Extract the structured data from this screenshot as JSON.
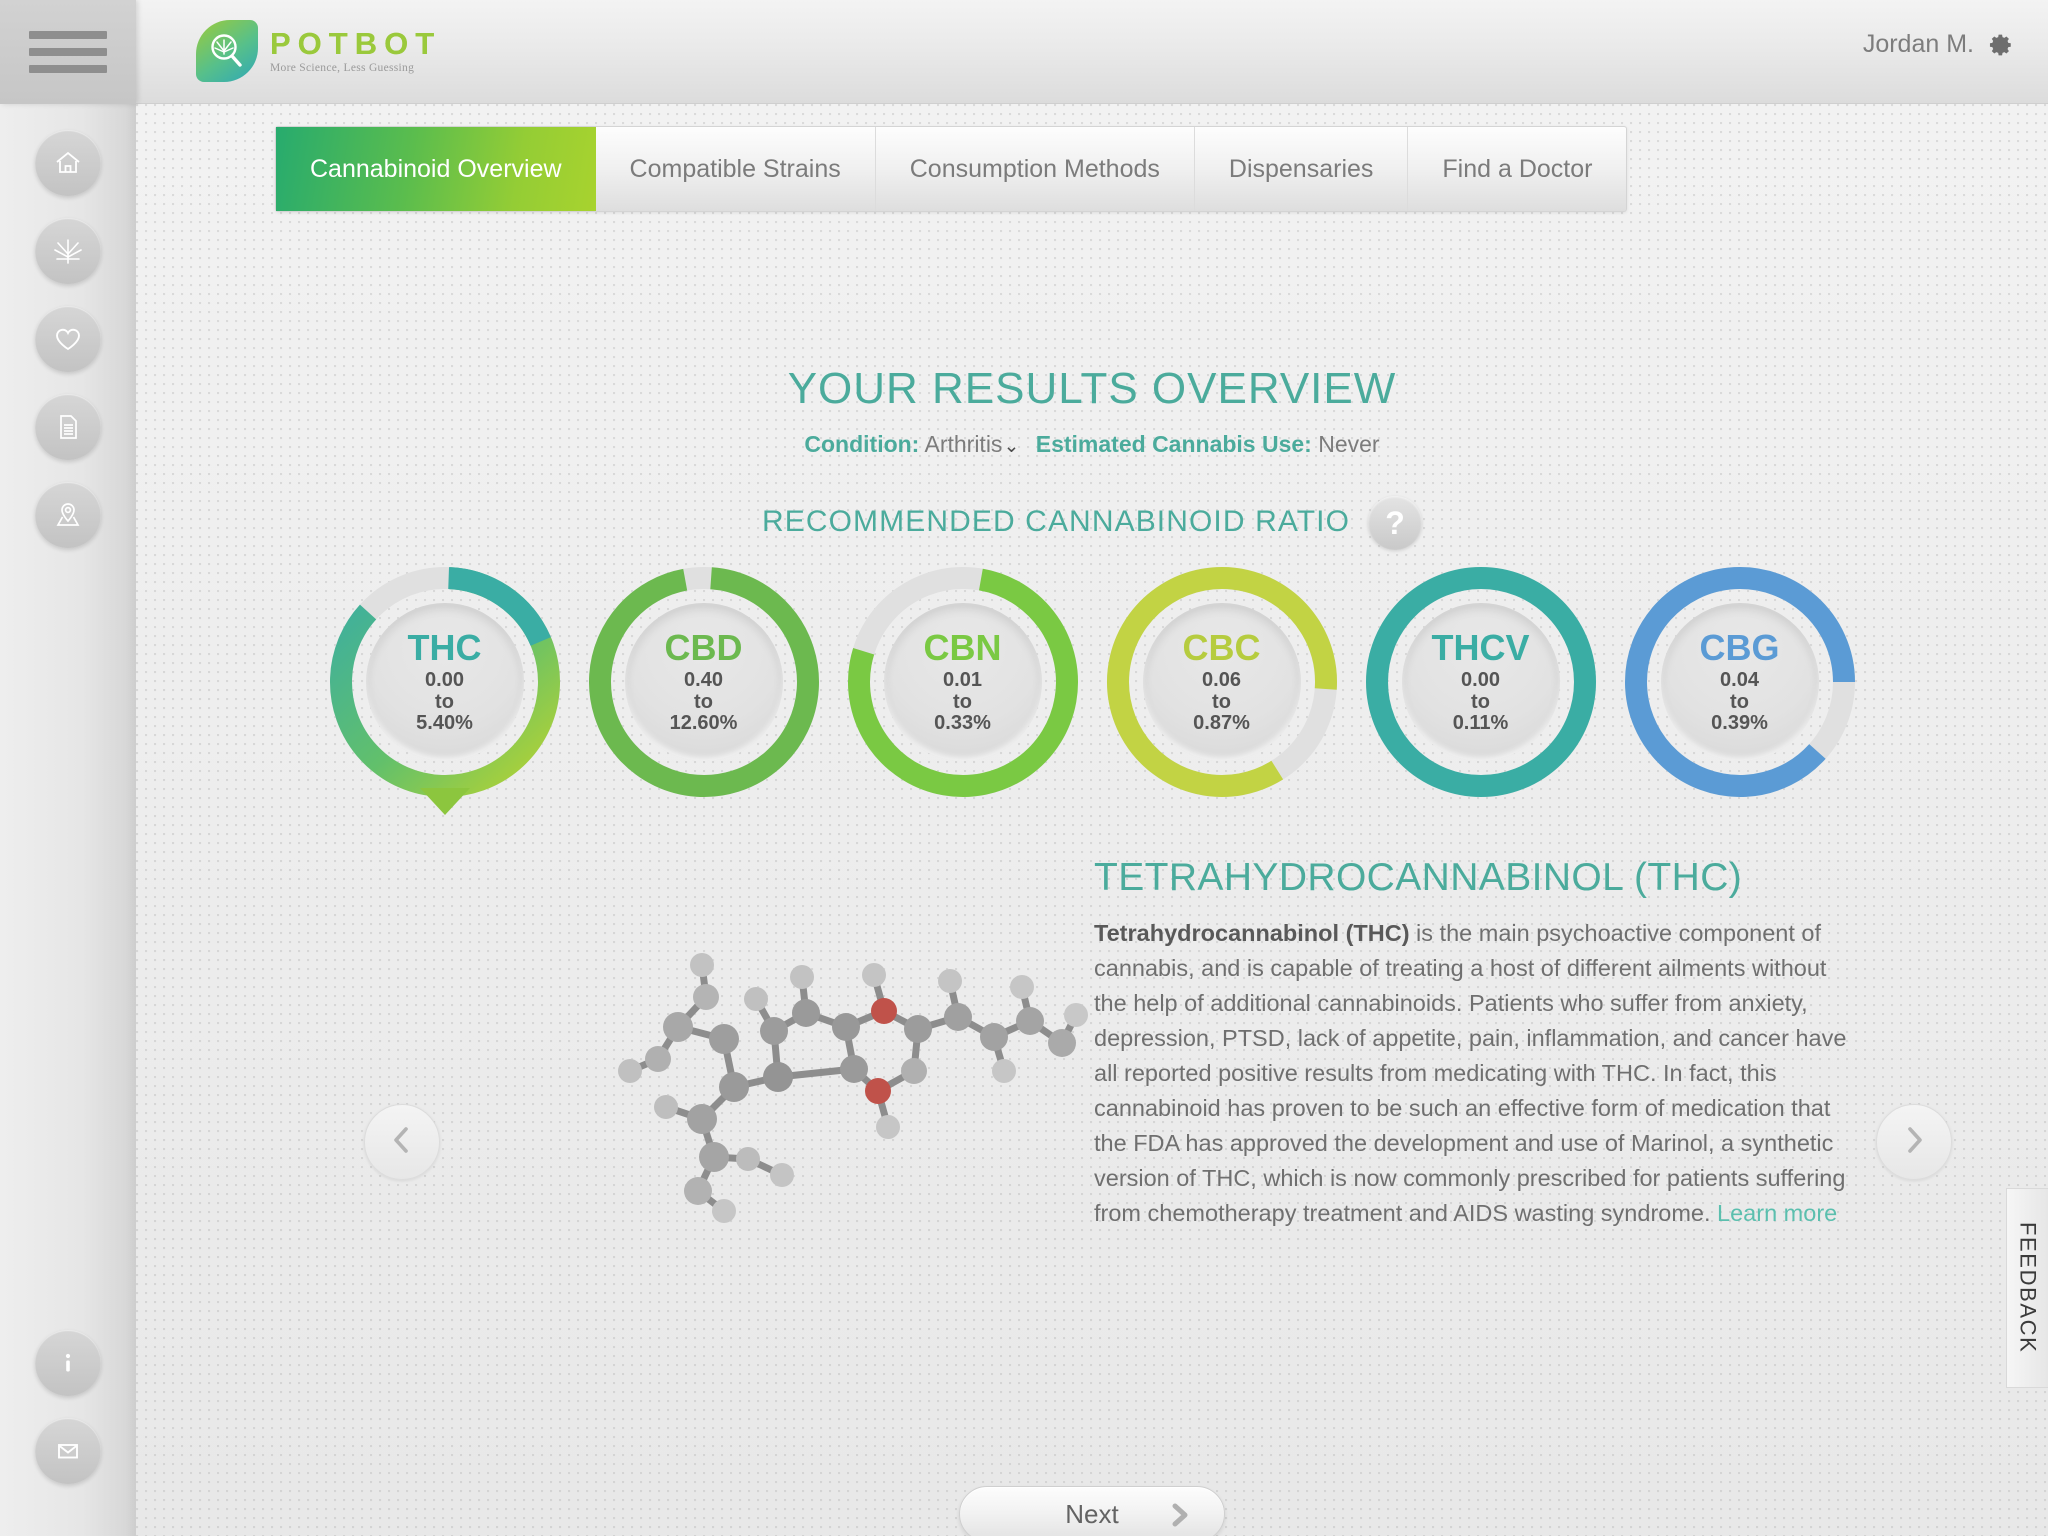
{
  "header": {
    "menu_icon": "hamburger-icon",
    "logo_word": "POTBOT",
    "logo_tagline": "More Science, Less Guessing",
    "user_name": "Jordan M.",
    "settings_icon": "gear-icon"
  },
  "sidebar": {
    "top_items": [
      {
        "icon": "home-icon",
        "name": "home"
      },
      {
        "icon": "cannabis-leaf-icon",
        "name": "strains"
      },
      {
        "icon": "heart-icon",
        "name": "favorites"
      },
      {
        "icon": "document-icon",
        "name": "reports"
      },
      {
        "icon": "map-pin-icon",
        "name": "locations"
      }
    ],
    "bottom_items": [
      {
        "icon": "info-icon",
        "name": "info"
      },
      {
        "icon": "mail-icon",
        "name": "contact"
      }
    ]
  },
  "tabs": [
    {
      "label": "Cannabinoid Overview",
      "active": true
    },
    {
      "label": "Compatible Strains",
      "active": false
    },
    {
      "label": "Consumption Methods",
      "active": false
    },
    {
      "label": "Dispensaries",
      "active": false
    },
    {
      "label": "Find a Doctor",
      "active": false
    }
  ],
  "results": {
    "title": "YOUR RESULTS OVERVIEW",
    "condition_label": "Condition:",
    "condition_value": "Arthritis",
    "condition_caret": "⌄",
    "usage_label": "Estimated Cannabis Use:",
    "usage_value": "Never",
    "ratio_title": "RECOMMENDED CANNABINOID RATIO",
    "help_label": "?"
  },
  "chart_data": {
    "type": "pie",
    "title": "RECOMMENDED CANNABINOID RATIO",
    "legend_position": "none",
    "cannabinoids": [
      {
        "name": "THC",
        "low": "0.00",
        "to": "to",
        "high": "5.40%",
        "low_value": 0.0,
        "high_value": 5.4,
        "pct_filled": 86,
        "gap_start_deg": 0,
        "color": "#3aada4",
        "accent_color": "#8cc63e",
        "selected": true
      },
      {
        "name": "CBD",
        "low": "0.40",
        "to": "to",
        "high": "12.60%",
        "low_value": 0.4,
        "high_value": 12.6,
        "pct_filled": 96,
        "gap_start_deg": 0,
        "color": "#6cb94f",
        "accent_color": "#6cb94f",
        "selected": false
      },
      {
        "name": "CBN",
        "low": "0.01",
        "to": "to",
        "high": "0.33%",
        "low_value": 0.01,
        "high_value": 0.33,
        "pct_filled": 77,
        "gap_start_deg": 290,
        "color": "#7ac943",
        "accent_color": "#7ac943",
        "selected": false
      },
      {
        "name": "CBC",
        "low": "0.06",
        "to": "to",
        "high": "0.87%",
        "low_value": 0.06,
        "high_value": 0.87,
        "pct_filled": 85,
        "gap_start_deg": 0,
        "color": "#c2d344",
        "accent_color": "#c2d344",
        "selected": false
      },
      {
        "name": "THCV",
        "low": "0.00",
        "to": "to",
        "high": "0.11%",
        "low_value": 0.0,
        "high_value": 0.11,
        "pct_filled": 100,
        "gap_start_deg": 0,
        "color": "#3aada4",
        "accent_color": "#3aada4",
        "selected": false
      },
      {
        "name": "CBG",
        "low": "0.04",
        "to": "to",
        "high": "0.39%",
        "low_value": 0.04,
        "high_value": 0.39,
        "pct_filled": 88,
        "gap_start_deg": 0,
        "color": "#5b9bd5",
        "accent_color": "#5b9bd5",
        "selected": false
      }
    ]
  },
  "detail": {
    "title": "TETRAHYDROCANNABINOL (THC)",
    "lead": "Tetrahydrocannabinol (THC)",
    "body": " is the main psychoactive component of cannabis, and is capable of treating a host of different ailments without the help of additional cannabinoids. Patients who suffer from anxiety, depression, PTSD, lack of appetite, pain, inflammation, and cancer have all reported positive results from medicating with THC. In fact, this cannabinoid has proven to be such an effective form of medication that the FDA has approved the development and use of Marinol, a synthetic version of THC, which is now commonly prescribed for patients suffering from chemotherapy treatment and AIDS wasting syndrome. ",
    "learn_more": "Learn more",
    "molecule_alt": "thc-molecule-model",
    "prev_icon": "chevron-left-icon",
    "next_icon": "chevron-right-icon"
  },
  "footer": {
    "next_label": "Next",
    "next_icon": "chevron-right-icon",
    "feedback_label": "FEEDBACK"
  },
  "colors": {
    "teal": "#4bab9c",
    "green": "#8cc63e",
    "text_gray": "#6f6f6f"
  }
}
